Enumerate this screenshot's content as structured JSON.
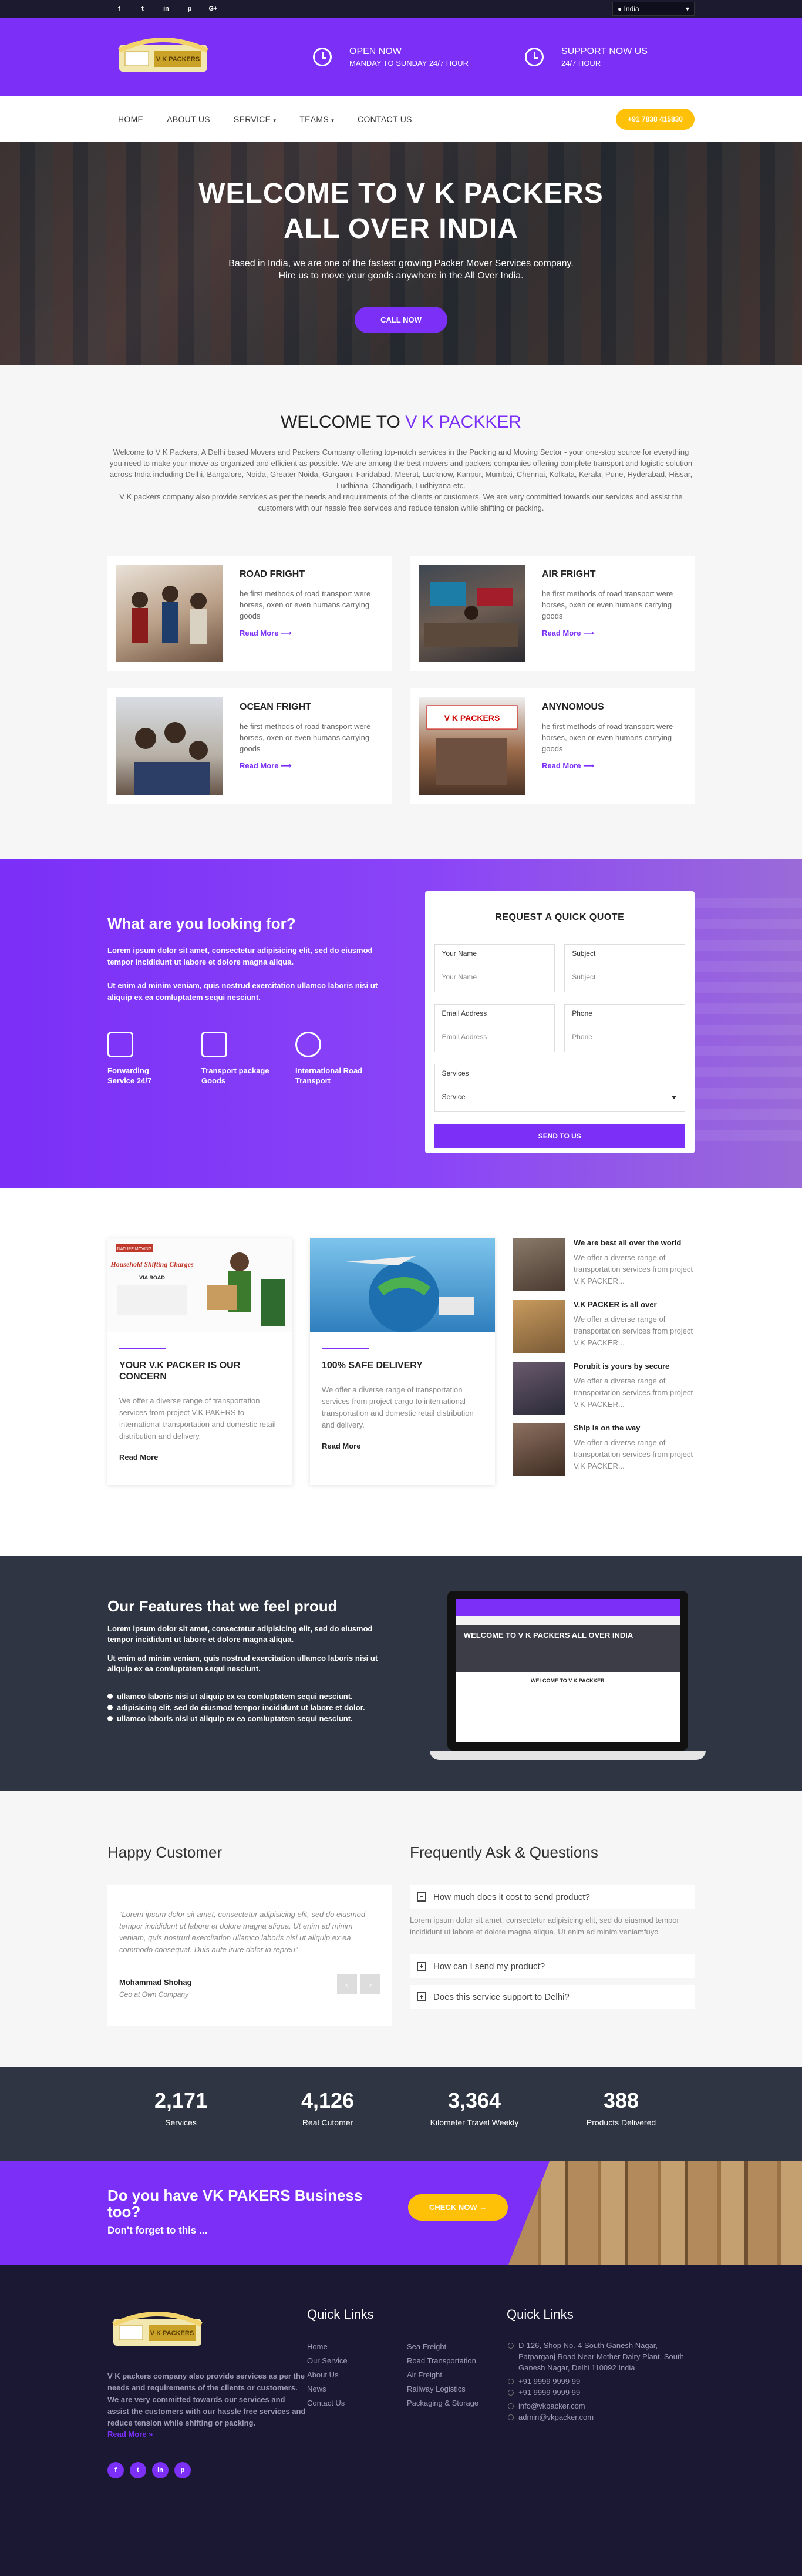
{
  "topbar": {
    "social": [
      "f",
      "t",
      "in",
      "p",
      "G+"
    ],
    "language": "India"
  },
  "header": {
    "logo_text": "V K PACKERS",
    "open_title": "Open now",
    "open_sub": "Manday to sunday 24/7 hour",
    "support_title": "Support now us",
    "support_sub": "24/7 hour"
  },
  "nav": {
    "items": [
      "Home",
      "About us",
      "Service",
      "Teams",
      "Contact us"
    ],
    "phone": "+91 7838 415830"
  },
  "hero": {
    "title_line1": "WELCOME TO V K PACKERS",
    "title_line2": "ALL OVER INDIA",
    "text": "Based in India, we are one of the fastest growing Packer Mover Services company. Hire us to move your goods anywhere in the All Over India.",
    "button": "CALL NOW"
  },
  "welcome": {
    "title": "WELCOME TO ",
    "title_accent": "V K PACKKER",
    "desc1": "Welcome to V K Packers, A Delhi based Movers and Packers Company offering top-notch services in the Packing and Moving Sector - your one-stop source for everything you need to make your move as organized and efficient as possible. We are among the best movers and packers companies offering complete transport and logistic solution across India including Delhi, Bangalore, Noida, Greater Noida, Gurgaon, Faridabad, Meerut, Lucknow, Kanpur, Mumbai, Chennai, Kolkata, Kerala, Pune, Hyderabad, Hissar, Ludhiana, Chandigarh, Ludhiyana etc.",
    "desc2": "V K packers company also provide services as per the needs and requirements of the clients or customers. We are very committed towards our services and assist the customers with our hassle free services and reduce tension while shifting or packing.",
    "services": [
      {
        "title": "ROAD FRIGHT",
        "text": "he first methods of road transport were horses, oxen or even humans carrying goods",
        "link": "Read More"
      },
      {
        "title": "AIR FRIGHT",
        "text": "he first methods of road transport were horses, oxen or even humans carrying goods",
        "link": "Read More"
      },
      {
        "title": "OCEAN FRIGHT",
        "text": "he first methods of road transport were horses, oxen or even humans carrying goods",
        "link": "Read More"
      },
      {
        "title": "ANYNOMOUS",
        "text": "he first methods of road transport were horses, oxen or even humans carrying goods",
        "link": "Read More"
      }
    ]
  },
  "quote": {
    "title": "What are you looking for?",
    "p1": "Lorem ipsum dolor sit amet, consectetur adipisicing elit, sed do eiusmod tempor incididunt ut labore et dolore magna aliqua.",
    "p2": "Ut enim ad minim veniam, quis nostrud exercitation ullamco laboris nisi ut aliquip ex ea comluptatem sequi nesciunt.",
    "icons": [
      "Forwarding Service 24/7",
      "Transport package Goods",
      "International Road Transport"
    ],
    "form_title": "REQUEST A QUICK QUOTE",
    "fields": [
      {
        "label": "Your Name",
        "placeholder": "Your Name"
      },
      {
        "label": "Subject",
        "placeholder": "Subject"
      },
      {
        "label": "Email Address",
        "placeholder": "Email Address"
      },
      {
        "label": "Phone",
        "placeholder": "Phone"
      }
    ],
    "services_label": "Services",
    "services_value": "Service",
    "submit": "SEND TO US"
  },
  "concern": {
    "cards": [
      {
        "title": "YOUR V.K PACKER IS OUR CONCERN",
        "text": "We offer a diverse range of transportation services from project V.K PAKERS to international transportation and domestic retail distribution and delivery.",
        "link": "Read More",
        "banner_tag": "NATURE MOVING",
        "banner_title": "Household Shifting Charges",
        "banner_sub": "VIA ROAD"
      },
      {
        "title": "100% SAFE DELIVERY",
        "text": "We offer a diverse range of transportation services from project cargo to international transportation and domestic retail distribution and delivery.",
        "link": "Read More"
      }
    ],
    "list": [
      {
        "title": "We are best all over the world",
        "text": "We offer a diverse range of transportation services from project V.K PACKER..."
      },
      {
        "title": "V.K PACKER is all over",
        "text": "We offer a diverse range of transportation services from project V.K PACKER..."
      },
      {
        "title": "Porubit is yours by secure",
        "text": "We offer a diverse range of transportation services from project V.K PACKER..."
      },
      {
        "title": "Ship is on the way",
        "text": "We offer a diverse range of transportation services from project V.K PACKER..."
      }
    ]
  },
  "features": {
    "title": "Our Features that we feel proud",
    "p1": "Lorem ipsum dolor sit amet, consectetur adipisicing elit, sed do eiusmod tempor incididunt ut labore et dolore magna aliqua.",
    "p2": "Ut enim ad minim veniam, quis nostrud exercitation ullamco laboris nisi ut aliquip ex ea comluptatem sequi nesciunt.",
    "bullets": [
      "ullamco laboris nisi ut aliquip ex ea comluptatem sequi nesciunt.",
      "adipisicing elit, sed do eiusmod tempor incididunt ut labore et dolor.",
      "ullamco laboris nisi ut aliquip ex ea comluptatem sequi nesciunt."
    ],
    "screen_hero": "WELCOME TO V K PACKERS ALL OVER INDIA",
    "screen_title": "WELCOME TO V K PACKKER"
  },
  "testimonial": {
    "title": "Happy Customer",
    "quote": "Lorem ipsum dolor sit amet, consectetur adipisicing elit, sed do eiusmod tempor incididunt ut labore et dolore magna aliqua. Ut enim ad minim veniam, quis nostrud exercitation ullamco laboris nisi ut aliquip ex ea commodo consequat. Duis aute irure dolor in repreu",
    "name": "Mohammad Shohag",
    "role": "Ceo at Own Company"
  },
  "faq": {
    "title": "Frequently Ask & Questions",
    "items": [
      {
        "q": "How much does it cost to send product?",
        "a": "Lorem ipsum dolor sit amet, consectetur adipisicing elit, sed do eiusmod tempor incididunt ut labore et dolore magna aliqua. Ut enim ad minim veniamfuyo"
      },
      {
        "q": "How can I send my product?"
      },
      {
        "q": "Does this service support to Delhi?"
      }
    ]
  },
  "counters": [
    {
      "n": "2,171",
      "l": "Services"
    },
    {
      "n": "4,126",
      "l": "Real Cutomer"
    },
    {
      "n": "3,364",
      "l": "Kilometer Travel Weekly"
    },
    {
      "n": "388",
      "l": "Products Delivered"
    }
  ],
  "cta": {
    "title": "Do you have VK PAKERS Business too?",
    "sub": "Don't forget to this ...",
    "button": "CHECK NOW →"
  },
  "footer": {
    "about": "V K packers company also provide services as per the needs and requirements of the clients or customers. We are very committed towards our services and assist the customers with our hassle free services and reduce tension while shifting or packing.",
    "read_more": "Read More »",
    "quick_links_title": "Quick Links",
    "links_col1": [
      "Home",
      "Our Service",
      "About Us",
      "News",
      "Contact Us"
    ],
    "links_col2": [
      "Sea Freight",
      "Road Transportation",
      "Air Freight",
      "Railway Logistics",
      "Packaging & Storage"
    ],
    "contact_title": "Quick Links",
    "address": "D-126, Shop No.-4 South Ganesh Nagar, Patparganj Road Near Mother Dairy Plant, South Ganesh Nagar, Delhi 110092 India",
    "phone1": "+91 9999 9999 99",
    "phone2": "+91 9999 9999 99",
    "email1": "info@vkpacker.com",
    "email2": "admin@vkpacker.com",
    "social": [
      "f",
      "t",
      "in",
      "p"
    ]
  }
}
